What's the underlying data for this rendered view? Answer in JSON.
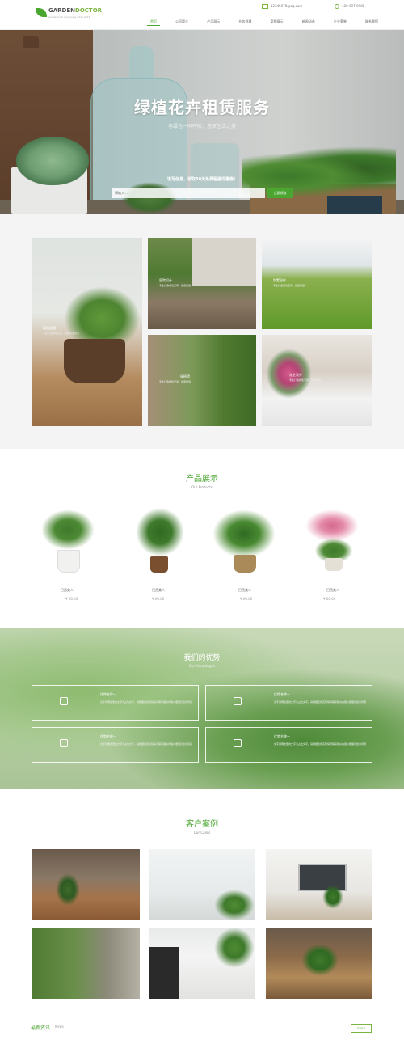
{
  "header": {
    "logo_main_1": "GARDEN",
    "logo_main_2": "DOCTOR",
    "logo_sub": "professional gardening 2015-2016",
    "email": "12345678@qq.com",
    "phone": "400-097-0988",
    "nav": [
      "首页",
      "公司简介",
      "产品展示",
      "业务领域",
      "案例展示",
      "新闻动态",
      "企业荣誉",
      "联系我们"
    ],
    "active_index": 0
  },
  "hero": {
    "title": "绿植花卉租赁服务",
    "subtitle": "与绿色一同呼吸，悠享生活之美",
    "form_msg": "填写信息，领取30天免费租摆优惠券！",
    "input_placeholder": "请输入...",
    "button": "立即领取"
  },
  "services": [
    {
      "label": "绿植租摆",
      "desc": "专业打造绿色空间，健康舒适生活"
    },
    {
      "label": "庭院设计",
      "desc": "专业打造绿色空间，健康舒适"
    },
    {
      "label": "别墅园林",
      "desc": "专业打造绿色空间，健康舒适"
    },
    {
      "label": "绿植墙",
      "desc": "专业打造绿色空间，健康舒适"
    },
    {
      "label": "花艺设计",
      "desc": "专业打造绿色空间，健康舒适"
    }
  ],
  "products": {
    "title": "产品展示",
    "subtitle": "Our Products",
    "items": [
      {
        "name": "巴西美人",
        "price": "¥ 00.00"
      },
      {
        "name": "巴西美人",
        "price": "¥ 00.00"
      },
      {
        "name": "巴西美人",
        "price": "¥ 00.00"
      },
      {
        "name": "巴西美人",
        "price": "¥ 00.00"
      }
    ]
  },
  "advantages": {
    "title": "我们的优势",
    "subtitle": "Our Advantages",
    "items": [
      {
        "title": "优势名称一",
        "desc": "文字说明这里的文字为占位文字，请根据您的实际情况填写相关内容以便展示给访问者"
      },
      {
        "title": "优势名称一",
        "desc": "文字说明这里的文字为占位文字，请根据您的实际情况填写相关内容以便展示给访问者"
      },
      {
        "title": "优势名称一",
        "desc": "文字说明这里的文字为占位文字，请根据您的实际情况填写相关内容以便展示给访问者"
      },
      {
        "title": "优势名称一",
        "desc": "文字说明这里的文字为占位文字，请根据您的实际情况填写相关内容以便展示给访问者"
      }
    ]
  },
  "cases": {
    "title": "客户案例",
    "subtitle": "Our Cases"
  },
  "news": {
    "title": "最新资讯",
    "subtitle": "News",
    "more": "more"
  },
  "colors": {
    "accent": "#4aa531",
    "accent_light": "#7ab53f"
  }
}
